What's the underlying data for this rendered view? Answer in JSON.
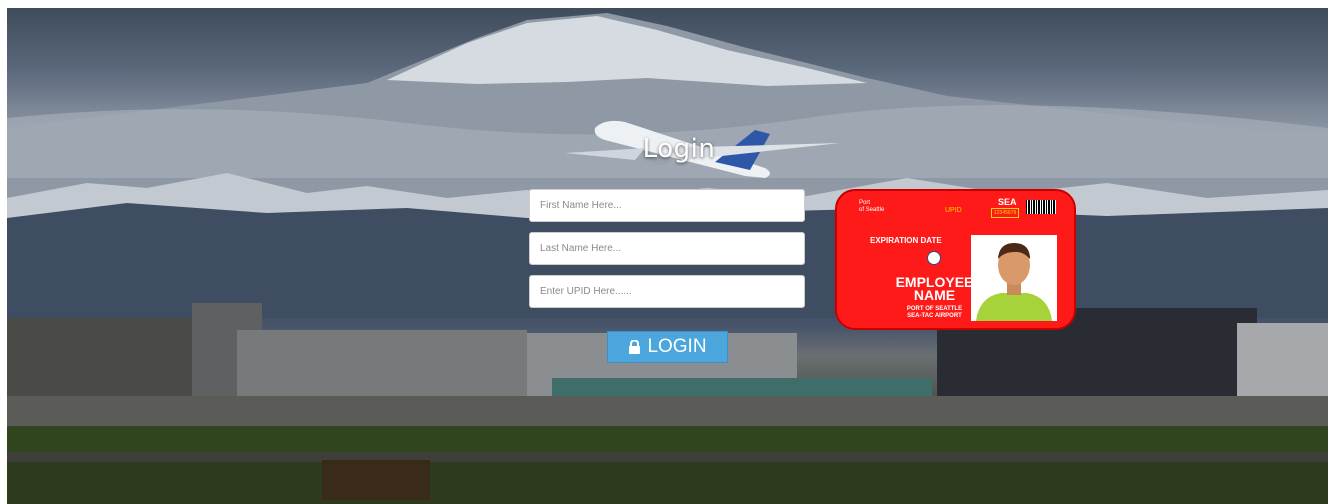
{
  "login": {
    "title": "Login",
    "first_name_placeholder": "First Name Here...",
    "last_name_placeholder": "Last Name Here...",
    "upid_placeholder": "Enter UPID Here......",
    "button_label": "LOGIN"
  },
  "badge": {
    "port_line1": "Port",
    "port_line2": "of Seattle",
    "upid_label": "UPID",
    "upid_number": "12345678",
    "sea": "SEA",
    "expiration": "EXPIRATION DATE",
    "employee_line1": "EMPLOYEE",
    "employee_line2": "NAME",
    "org_line1": "PORT OF SEATTLE",
    "org_line2": "SEA-TAC AIRPORT",
    "color": "#ff1a1a"
  },
  "colors": {
    "button": "#4aa6dc"
  }
}
